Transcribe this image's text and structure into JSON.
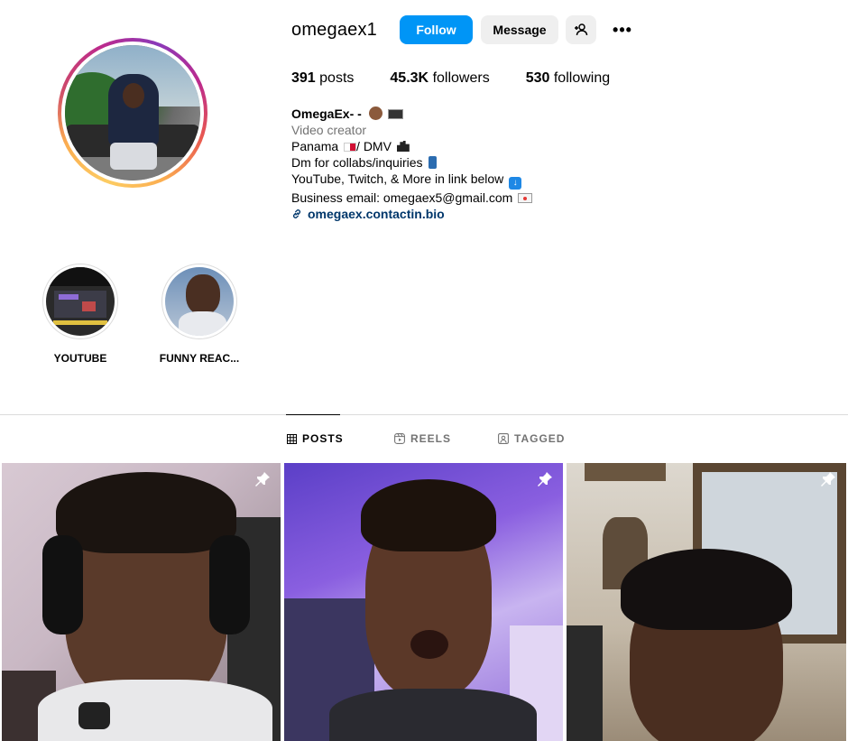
{
  "profile": {
    "username": "omegaex1",
    "follow_label": "Follow",
    "message_label": "Message",
    "more_label": "•••"
  },
  "stats": {
    "posts_count": "391",
    "posts_label": "posts",
    "followers_count": "45.3K",
    "followers_label": "followers",
    "following_count": "530",
    "following_label": "following"
  },
  "bio": {
    "name": "OmegaEx- -",
    "category": "Video creator",
    "line1": "Panama",
    "line1_suffix": "/ DMV",
    "line2": "Dm for collabs/inquiries",
    "line3": "YouTube, Twitch, & More in link below",
    "line4": "Business email: omegaex5@gmail.com",
    "link": "omegaex.contactin.bio"
  },
  "highlights": [
    {
      "label": "YOUTUBE"
    },
    {
      "label": "FUNNY REAC..."
    }
  ],
  "tabs": [
    {
      "label": "POSTS",
      "icon": "grid-icon",
      "active": true
    },
    {
      "label": "REELS",
      "icon": "reels-icon",
      "active": false
    },
    {
      "label": "TAGGED",
      "icon": "tagged-icon",
      "active": false
    }
  ],
  "posts": [
    {
      "pinned": true
    },
    {
      "pinned": true
    },
    {
      "pinned": true
    }
  ],
  "colors": {
    "follow_button": "#0095f6",
    "link": "#00376b",
    "secondary_text": "#737373"
  }
}
